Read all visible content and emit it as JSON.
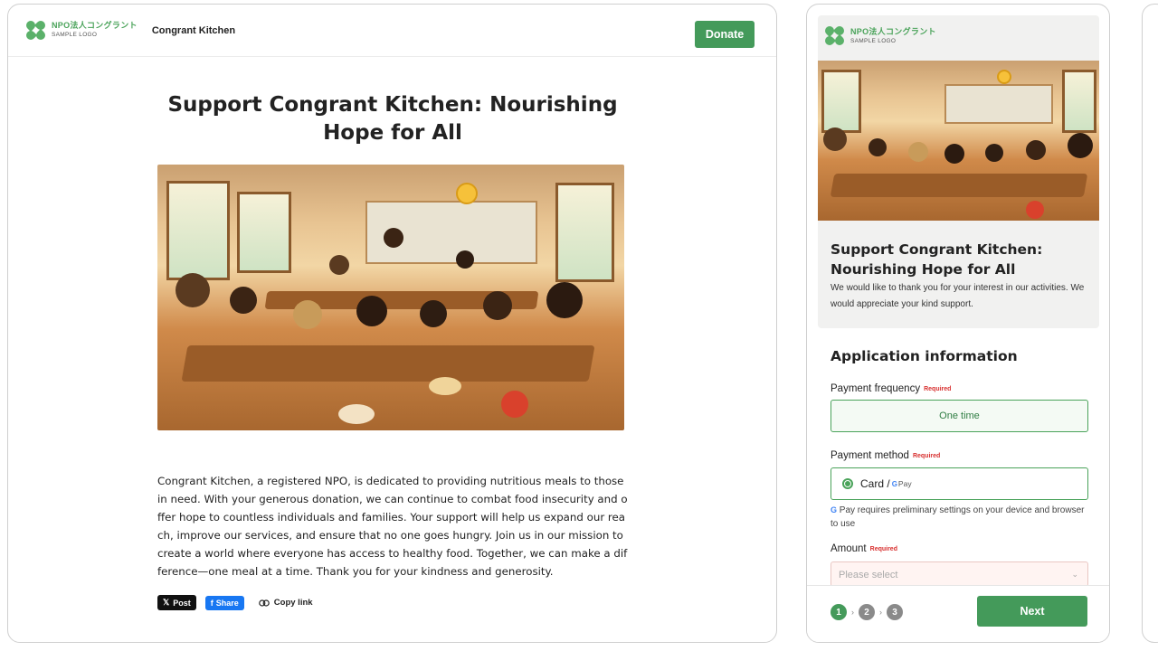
{
  "logo": {
    "jp": "NPO法人コングラント",
    "sub": "SAMPLE LOGO"
  },
  "left": {
    "org_name": "Congrant Kitchen",
    "donate_label": "Donate",
    "title": "Support Congrant Kitchen: Nourishing Hope for All",
    "description": "Congrant Kitchen, a registered NPO, is dedicated to providing nutritious meals to those in need. With your generous donation, we can continue to combat food insecurity and offer hope to countless individuals and families. Your support will help us expand our reach, improve our services, and ensure that no one goes hungry. Join us in our mission to create a world where everyone has access to healthy food. Together, we can make a difference—one meal at a time. Thank you for your kindness and generosity.",
    "share": {
      "x_label": "Post",
      "fb_label": "Share",
      "copy_label": "Copy link"
    }
  },
  "right": {
    "title": "Support Congrant Kitchen: Nourishing Hope for All",
    "intro": "We would like to thank you for your interest in our activities. We would appreciate your kind support.",
    "section_heading": "Application information",
    "required_label": "Required",
    "frequency": {
      "label": "Payment frequency",
      "value": "One time"
    },
    "method": {
      "label": "Payment method",
      "value": "Card / ",
      "gpay": "Pay",
      "note": "Pay requires preliminary settings on your device and browser to use"
    },
    "amount": {
      "label": "Amount",
      "placeholder": "Please select"
    },
    "steps": [
      "1",
      "2",
      "3"
    ],
    "next_label": "Next"
  },
  "colors": {
    "accent": "#449a5a",
    "required": "#d8302f"
  }
}
